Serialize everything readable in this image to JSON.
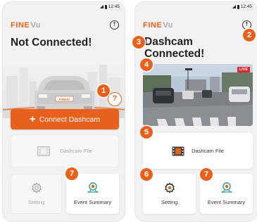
{
  "brand": {
    "logo_main": "FINE",
    "logo_sub": "Vu"
  },
  "status_bar": {
    "time": "12:45"
  },
  "left_screen": {
    "title": "Not Connected!",
    "connect_button": "Connect Dashcam",
    "dashcam_file": "Dashcam File",
    "setting": "Setting",
    "event_summary": "Event Summary",
    "plate_text": "FINEVU",
    "callouts": {
      "help": "1",
      "event": "7"
    },
    "help_icon": "?"
  },
  "right_screen": {
    "title_line1": "Dashcam",
    "title_line2": "Connected!",
    "live_badge": "LIVE",
    "dashcam_file": "Dashcam File",
    "setting": "Setting",
    "event_summary": "Event Summary",
    "callouts": {
      "upload": "2",
      "title": "3",
      "live": "4",
      "file": "5",
      "setting": "6",
      "event": "7"
    }
  },
  "colors": {
    "accent": "#e8611c",
    "live_red": "#e0262a"
  },
  "icons": [
    "upload-icon",
    "film-icon",
    "gear-icon",
    "event-camera-icon",
    "help-icon",
    "signal-icon",
    "battery-icon"
  ]
}
